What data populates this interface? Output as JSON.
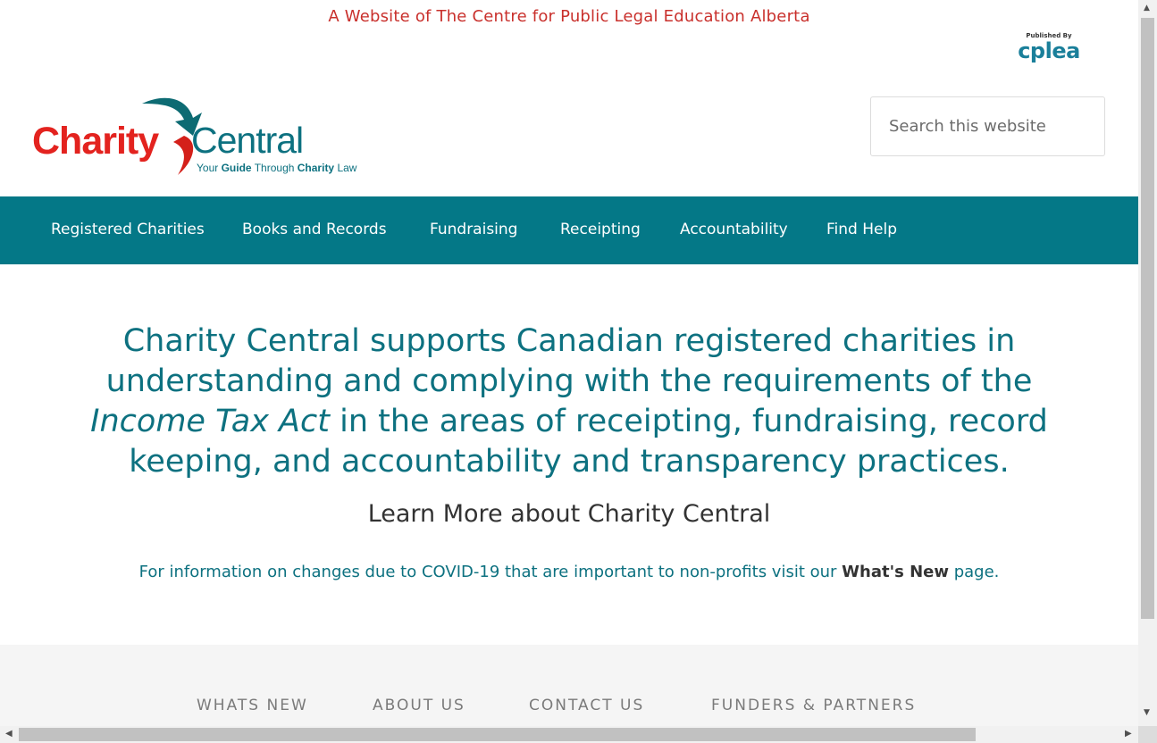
{
  "top_banner": "A Website of The Centre for Public Legal Education Alberta",
  "publisher": {
    "caption": "Published By",
    "name": "cplea"
  },
  "logo": {
    "word1": "Charity",
    "word2": "Central",
    "tagline_part1": "Your ",
    "tagline_bold1": "Guide",
    "tagline_part2": " Through ",
    "tagline_bold2": "Charity",
    "tagline_part3": " Law"
  },
  "search": {
    "placeholder": "Search this website"
  },
  "nav": {
    "items": [
      {
        "label": "Registered Charities"
      },
      {
        "label": "Books and Records"
      },
      {
        "label": "Fundraising"
      },
      {
        "label": "Receipting"
      },
      {
        "label": "Accountability"
      },
      {
        "label": "Find Help"
      }
    ]
  },
  "hero": {
    "line_start": "Charity Central supports Canadian registered charities in understanding and complying with the requirements of the ",
    "act": "Income Tax Act",
    "line_end": " in the areas of receipting, fundraising, record keeping, and accountability and transparency practices."
  },
  "learn_more": "Learn More about Charity Central",
  "covid": {
    "text_before": "For information on changes due to COVID-19 that are important to non-profits visit our ",
    "link": "What's New",
    "text_after": " page."
  },
  "footer": {
    "links": [
      {
        "label": "WHATS NEW"
      },
      {
        "label": "ABOUT US"
      },
      {
        "label": "CONTACT US"
      },
      {
        "label": "FUNDERS & PARTNERS"
      }
    ]
  },
  "colors": {
    "teal": "#047887",
    "red": "#e3231f",
    "text_teal": "#0d7180"
  }
}
